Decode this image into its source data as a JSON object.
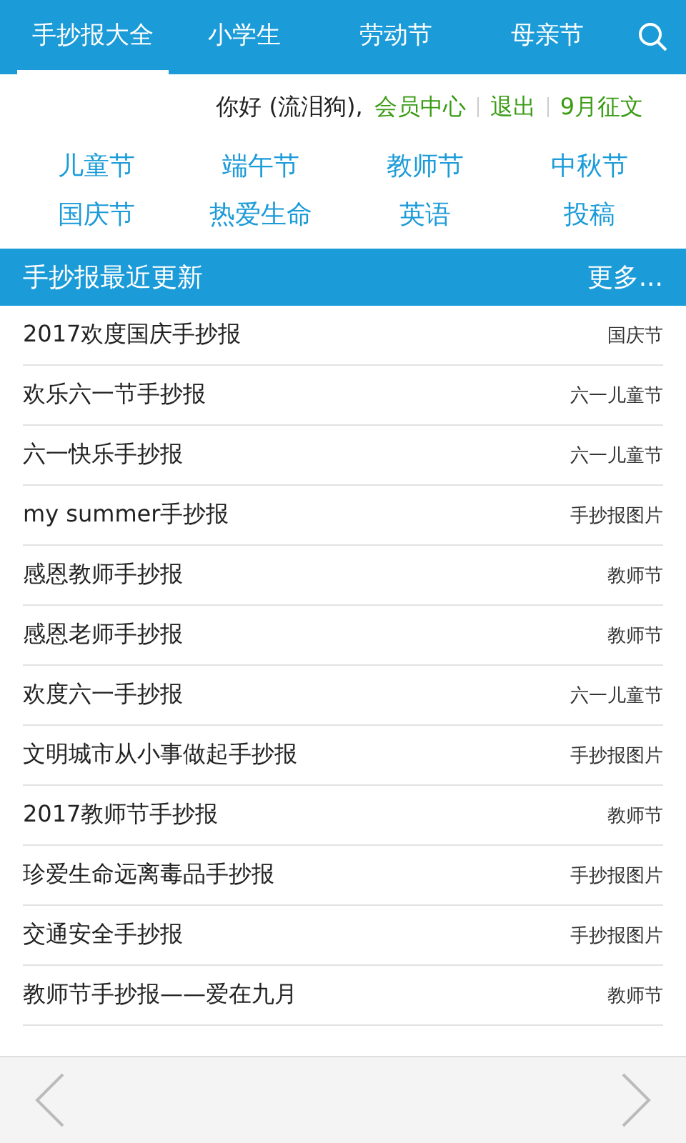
{
  "tabs": [
    {
      "label": "手抄报大全",
      "selected": true
    },
    {
      "label": "小学生",
      "selected": false
    },
    {
      "label": "劳动节",
      "selected": false
    },
    {
      "label": "母亲节",
      "selected": false
    }
  ],
  "user_bar": {
    "greeting": "你好 (流泪狗),",
    "links": [
      "会员中心",
      "退出",
      "9月征文"
    ]
  },
  "categories": [
    "儿童节",
    "端午节",
    "教师节",
    "中秋节",
    "国庆节",
    "热爱生命",
    "英语",
    "投稿"
  ],
  "section": {
    "title": "手抄报最近更新",
    "more": "更多..."
  },
  "articles": [
    {
      "title": "2017欢度国庆手抄报",
      "category": "国庆节"
    },
    {
      "title": "欢乐六一节手抄报",
      "category": "六一儿童节"
    },
    {
      "title": "六一快乐手抄报",
      "category": "六一儿童节"
    },
    {
      "title": "my summer手抄报",
      "category": "手抄报图片"
    },
    {
      "title": "感恩教师手抄报",
      "category": "教师节"
    },
    {
      "title": "感恩老师手抄报",
      "category": "教师节"
    },
    {
      "title": "欢度六一手抄报",
      "category": "六一儿童节"
    },
    {
      "title": "文明城市从小事做起手抄报",
      "category": "手抄报图片"
    },
    {
      "title": "2017教师节手抄报",
      "category": "教师节"
    },
    {
      "title": "珍爱生命远离毒品手抄报",
      "category": "手抄报图片"
    },
    {
      "title": "交通安全手抄报",
      "category": "手抄报图片"
    },
    {
      "title": "教师节手抄报——爱在九月",
      "category": "教师节"
    }
  ]
}
